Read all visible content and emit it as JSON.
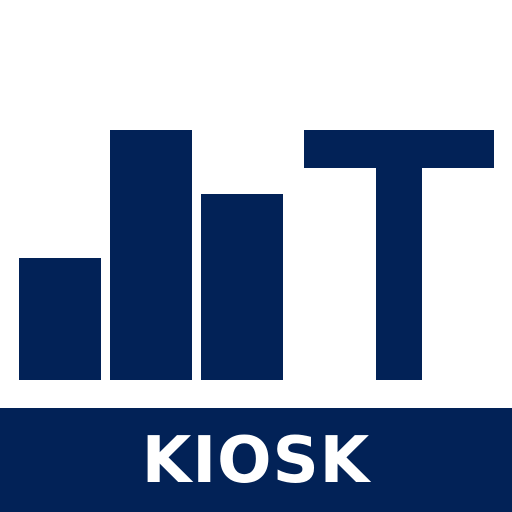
{
  "app_icon": {
    "banner_text": "KIOSK",
    "icon_name": "bar-chart-t-logo-icon",
    "colors": {
      "brand": "#022257",
      "background": "#ffffff",
      "banner_text": "#ffffff"
    }
  }
}
